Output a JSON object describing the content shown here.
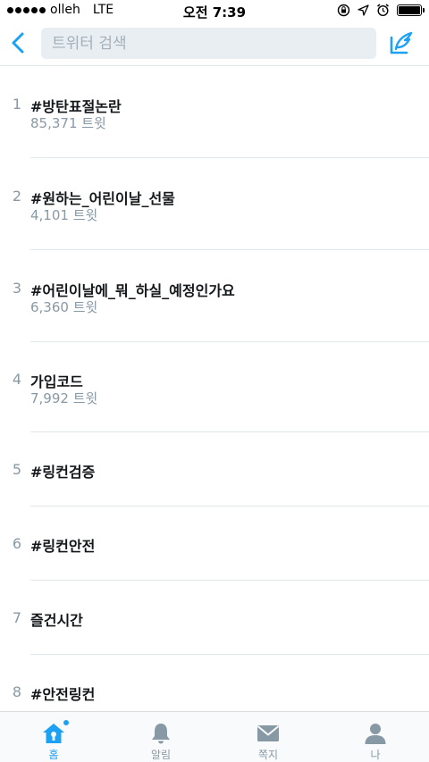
{
  "status_bar": {
    "carrier": "olleh",
    "network": "LTE",
    "time": "오전 7:39"
  },
  "search": {
    "placeholder": "트위터 검색"
  },
  "trends": [
    {
      "rank": "1",
      "name": "#방탄표절논란",
      "count": "85,371 트윗"
    },
    {
      "rank": "2",
      "name": "#원하는_어린이날_선물",
      "count": "4,101 트윗"
    },
    {
      "rank": "3",
      "name": "#어린이날에_뭐_하실_예정인가요",
      "count": "6,360 트윗"
    },
    {
      "rank": "4",
      "name": "가입코드",
      "count": "7,992 트윗"
    },
    {
      "rank": "5",
      "name": "#링컨검증"
    },
    {
      "rank": "6",
      "name": "#링컨안전"
    },
    {
      "rank": "7",
      "name": "즐건시간"
    },
    {
      "rank": "8",
      "name": "#안전링컨"
    }
  ],
  "tabs": [
    {
      "label": "홈",
      "icon": "home-icon"
    },
    {
      "label": "알림",
      "icon": "bell-icon"
    },
    {
      "label": "쪽지",
      "icon": "envelope-icon"
    },
    {
      "label": "나",
      "icon": "person-icon"
    }
  ],
  "colors": {
    "accent": "#1da1f2",
    "muted": "#8899a6",
    "text": "#14171a",
    "divider": "#e1e8ed"
  }
}
